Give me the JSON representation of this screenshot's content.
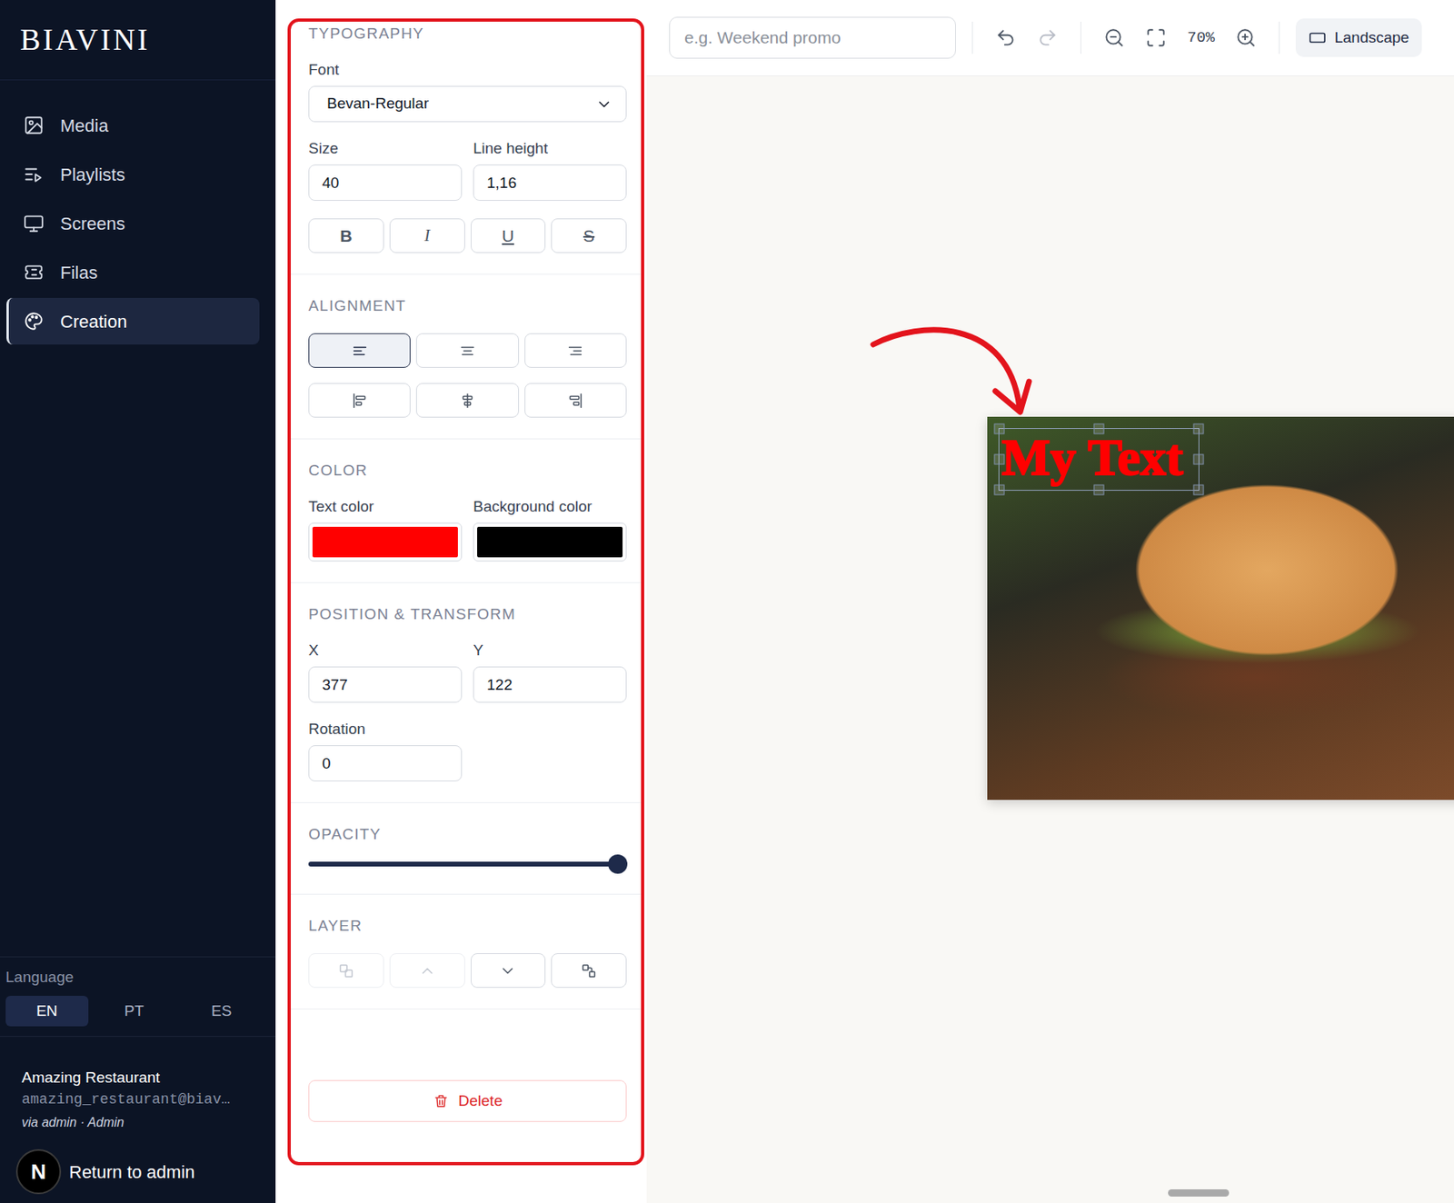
{
  "sidebar": {
    "logo": "BIAVINI",
    "items": [
      {
        "label": "Media",
        "selected": false
      },
      {
        "label": "Playlists",
        "selected": false
      },
      {
        "label": "Screens",
        "selected": false
      },
      {
        "label": "Filas",
        "selected": false
      },
      {
        "label": "Creation",
        "selected": true
      }
    ],
    "language": {
      "label": "Language",
      "options": [
        {
          "label": "EN",
          "selected": true
        },
        {
          "label": "PT",
          "selected": false
        },
        {
          "label": "ES",
          "selected": false
        }
      ]
    },
    "account": {
      "name": "Amazing Restaurant",
      "email": "amazing_restaurant@biav…",
      "via": "via admin · Admin"
    },
    "dev_badge": "N",
    "return_link": "Return to admin"
  },
  "panel": {
    "typography": {
      "title": "TYPOGRAPHY",
      "font_label": "Font",
      "font": "Bevan-Regular",
      "size_label": "Size",
      "size": "40",
      "line_height_label": "Line height",
      "line_height": "1,16",
      "styles": [
        {
          "label": "B",
          "kind": "bold",
          "selected": false
        },
        {
          "label": "I",
          "kind": "italic",
          "selected": false
        },
        {
          "label": "U",
          "kind": "underline",
          "selected": false
        },
        {
          "label": "S",
          "kind": "strike",
          "selected": false
        }
      ]
    },
    "alignment": {
      "title": "ALIGNMENT",
      "buttons": [
        {
          "kind": "text-left",
          "selected": true
        },
        {
          "kind": "text-center",
          "selected": false
        },
        {
          "kind": "text-right",
          "selected": false
        },
        {
          "kind": "obj-left",
          "selected": false
        },
        {
          "kind": "obj-center",
          "selected": false
        },
        {
          "kind": "obj-right",
          "selected": false
        }
      ]
    },
    "color": {
      "title": "COLOR",
      "text_label": "Text color",
      "text_color": "#ff0000",
      "background_label": "Background color",
      "background_color": "#000000"
    },
    "position": {
      "title": "POSITION & TRANSFORM",
      "x_label": "X",
      "x": "377",
      "y_label": "Y",
      "y": "122",
      "rotation_label": "Rotation",
      "rotation": "0"
    },
    "opacity": {
      "title": "OPACITY",
      "level": 1
    },
    "layer": {
      "title": "LAYER",
      "buttons": [
        {
          "kind": "front",
          "disabled": true
        },
        {
          "kind": "up",
          "disabled": true
        },
        {
          "kind": "down",
          "disabled": false
        },
        {
          "kind": "back",
          "disabled": false
        }
      ]
    },
    "delete": "Delete"
  },
  "toolbar": {
    "name_placeholder": "e.g. Weekend promo",
    "undo": {
      "disabled": false
    },
    "redo": {
      "disabled": true
    },
    "zoom": "70%",
    "orientation": "Landscape"
  },
  "canvas": {
    "text": "My Text",
    "text_color": "#ff0000",
    "selected": true
  }
}
